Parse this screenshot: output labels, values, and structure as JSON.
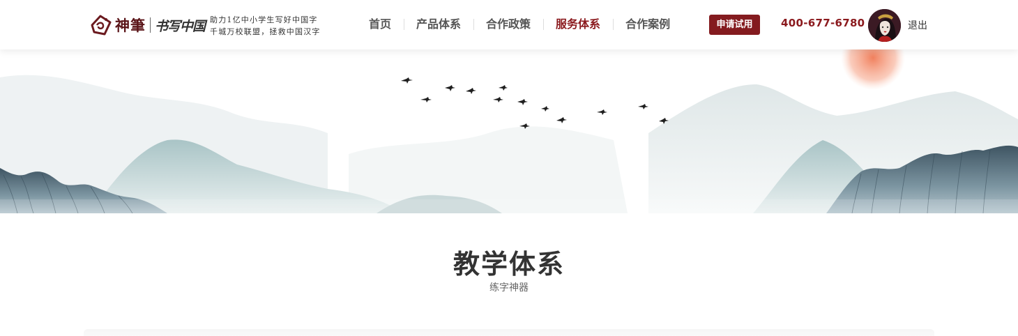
{
  "header": {
    "logo_brand": "神筆",
    "logo_product": "书写中国",
    "slogan_line1": "助力1亿中小学生写好中国字",
    "slogan_line2": "千城万校联盟，拯救中国汉字",
    "nav": [
      {
        "label": "首页",
        "active": false
      },
      {
        "label": "产品体系",
        "active": false
      },
      {
        "label": "合作政策",
        "active": false
      },
      {
        "label": "服务体系",
        "active": true
      },
      {
        "label": "合作案例",
        "active": false
      }
    ],
    "apply_label": "申请试用",
    "phone": "400-677-6780",
    "logout_label": "退出"
  },
  "section": {
    "title": "教学体系",
    "subtitle": "练字神器"
  },
  "colors": {
    "brand": "#841b1f",
    "active_nav": "#8b1a1e",
    "sun": "#f08a66"
  },
  "icons": [
    "logo-seal-icon",
    "user-avatar",
    "flying-birds",
    "ink-mountains"
  ]
}
